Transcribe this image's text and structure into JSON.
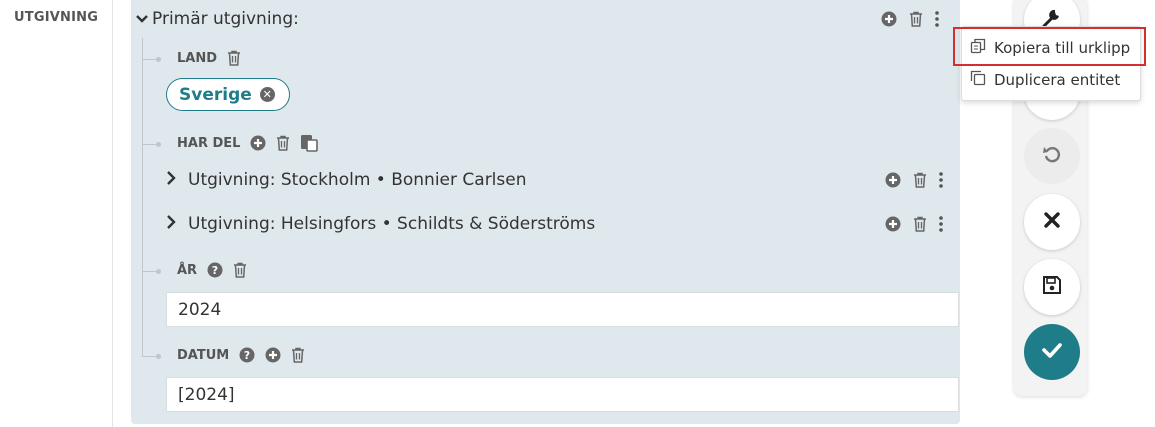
{
  "section_label": "UTGIVNING",
  "entity": {
    "title": "Primär utgivning:",
    "land": {
      "label": "LAND",
      "chip": "Sverige"
    },
    "har_del": {
      "label": "HAR DEL",
      "items": [
        {
          "label": "Utgivning: Stockholm • Bonnier Carlsen"
        },
        {
          "label": "Utgivning: Helsingfors • Schildts & Söderströms"
        }
      ]
    },
    "ar": {
      "label": "ÅR",
      "value": "2024"
    },
    "datum": {
      "label": "DATUM",
      "value": "[2024]"
    }
  },
  "context_menu": {
    "items": [
      {
        "label": "Kopiera till urklipp",
        "icon": "copy-icon",
        "highlighted": true
      },
      {
        "label": "Duplicera entitet",
        "icon": "duplicate-icon",
        "highlighted": false
      }
    ]
  },
  "toolbar": {
    "buttons": [
      "wrench-icon",
      "blank",
      "undo-icon",
      "close-icon",
      "save-icon",
      "check-icon"
    ],
    "primary_color": "#1f7d8a"
  },
  "colors": {
    "panel_bg": "#dfe8ec",
    "accent": "#1f7d8a",
    "highlight_border": "#d32f2f"
  }
}
